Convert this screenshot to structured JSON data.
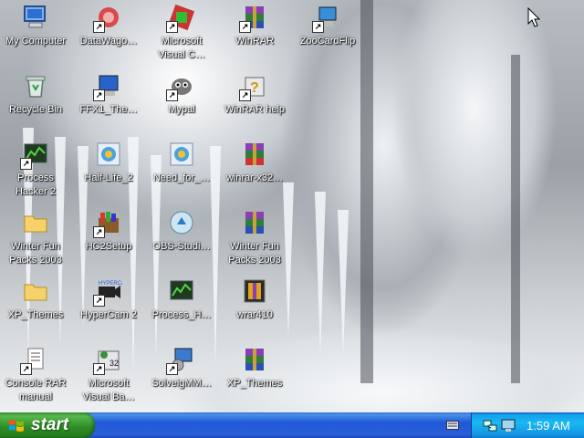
{
  "desktop": {
    "icons": [
      {
        "label": "My Computer",
        "icon": "my-computer-icon"
      },
      {
        "label": "DataWago…",
        "icon": "datawago-icon"
      },
      {
        "label": "Microsoft\nVisual C…",
        "icon": "visual-c-icon"
      },
      {
        "label": "WinRAR",
        "icon": "winrar-icon"
      },
      {
        "label": "ZooCardFlip",
        "icon": "zoocardflip-icon"
      },
      {
        "label": "Recycle Bin",
        "icon": "recycle-bin-icon"
      },
      {
        "label": "FFX1_The…",
        "icon": "ffx1-icon"
      },
      {
        "label": "Mypal",
        "icon": "mypal-icon"
      },
      {
        "label": "WinRAR help",
        "icon": "winrar-help-icon"
      },
      {
        "label": "Process\nHacker 2",
        "icon": "process-hacker-icon"
      },
      {
        "label": "Half-Life_2",
        "icon": "half-life-2-icon"
      },
      {
        "label": "Need_for_…",
        "icon": "need-for-speed-icon"
      },
      {
        "label": "winrar-x32…",
        "icon": "winrar-x32-icon"
      },
      {
        "label": "Winter Fun\nPacks 2003",
        "icon": "folder-icon"
      },
      {
        "label": "HC2Setup",
        "icon": "hc2setup-icon"
      },
      {
        "label": "OBS-Studi…",
        "icon": "obs-studio-icon"
      },
      {
        "label": "Winter Fun\nPacks 2003",
        "icon": "winrar-archive-icon"
      },
      {
        "label": "XP_Themes",
        "icon": "folder-icon"
      },
      {
        "label": "HyperCam 2",
        "icon": "hypercam-icon"
      },
      {
        "label": "Process_H…",
        "icon": "process-h-icon"
      },
      {
        "label": "wrar410",
        "icon": "wrar410-icon"
      },
      {
        "label": "Console RAR\nmanual",
        "icon": "console-rar-manual-icon"
      },
      {
        "label": "Microsoft\nVisual Ba…",
        "icon": "visual-basic-icon"
      },
      {
        "label": "SolveigMM…",
        "icon": "solveigmm-icon"
      },
      {
        "label": "XP_Themes",
        "icon": "winrar-archive-icon"
      }
    ]
  },
  "taskbar": {
    "start_label": "start",
    "clock": "1:59 AM",
    "tray_icons": [
      "network-icon",
      "monitor-icon"
    ]
  },
  "colors": {
    "taskbar_blue": "#2157d7",
    "start_green": "#2d8b25",
    "tray_blue": "#18b9f3"
  }
}
